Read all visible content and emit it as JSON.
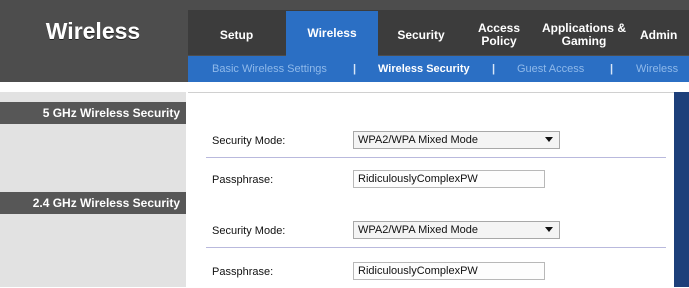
{
  "app": {
    "title": "Wireless"
  },
  "tabs": [
    {
      "label": "Setup",
      "active": false
    },
    {
      "label": "Wireless",
      "active": true
    },
    {
      "label": "Security",
      "active": false
    },
    {
      "label": "Access\nPolicy",
      "active": false
    },
    {
      "label": "Applications &\nGaming",
      "active": false
    },
    {
      "label": "Admin",
      "active": false
    }
  ],
  "subnav": {
    "items": [
      {
        "label": "Basic Wireless Settings",
        "active": false
      },
      {
        "label": "Wireless Security",
        "active": true
      },
      {
        "label": "Guest Access",
        "active": false
      },
      {
        "label": "Wireless",
        "active": false
      }
    ],
    "separator": "|"
  },
  "sections": [
    {
      "title": "5 GHz Wireless Security",
      "security_mode_label": "Security Mode:",
      "security_mode_value": "WPA2/WPA Mixed Mode",
      "passphrase_label": "Passphrase:",
      "passphrase_value": "RidiculouslyComplexPW"
    },
    {
      "title": "2.4 GHz Wireless Security",
      "security_mode_label": "Security Mode:",
      "security_mode_value": "WPA2/WPA Mixed Mode",
      "passphrase_label": "Passphrase:",
      "passphrase_value": "RidiculouslyComplexPW"
    }
  ],
  "colors": {
    "header_bg": "#4d4d4d",
    "accent_blue": "#2b6fc4",
    "sidebar_bg": "#e2e2e2",
    "section_label_bg": "#575757",
    "right_bar": "#1d3f7a"
  }
}
